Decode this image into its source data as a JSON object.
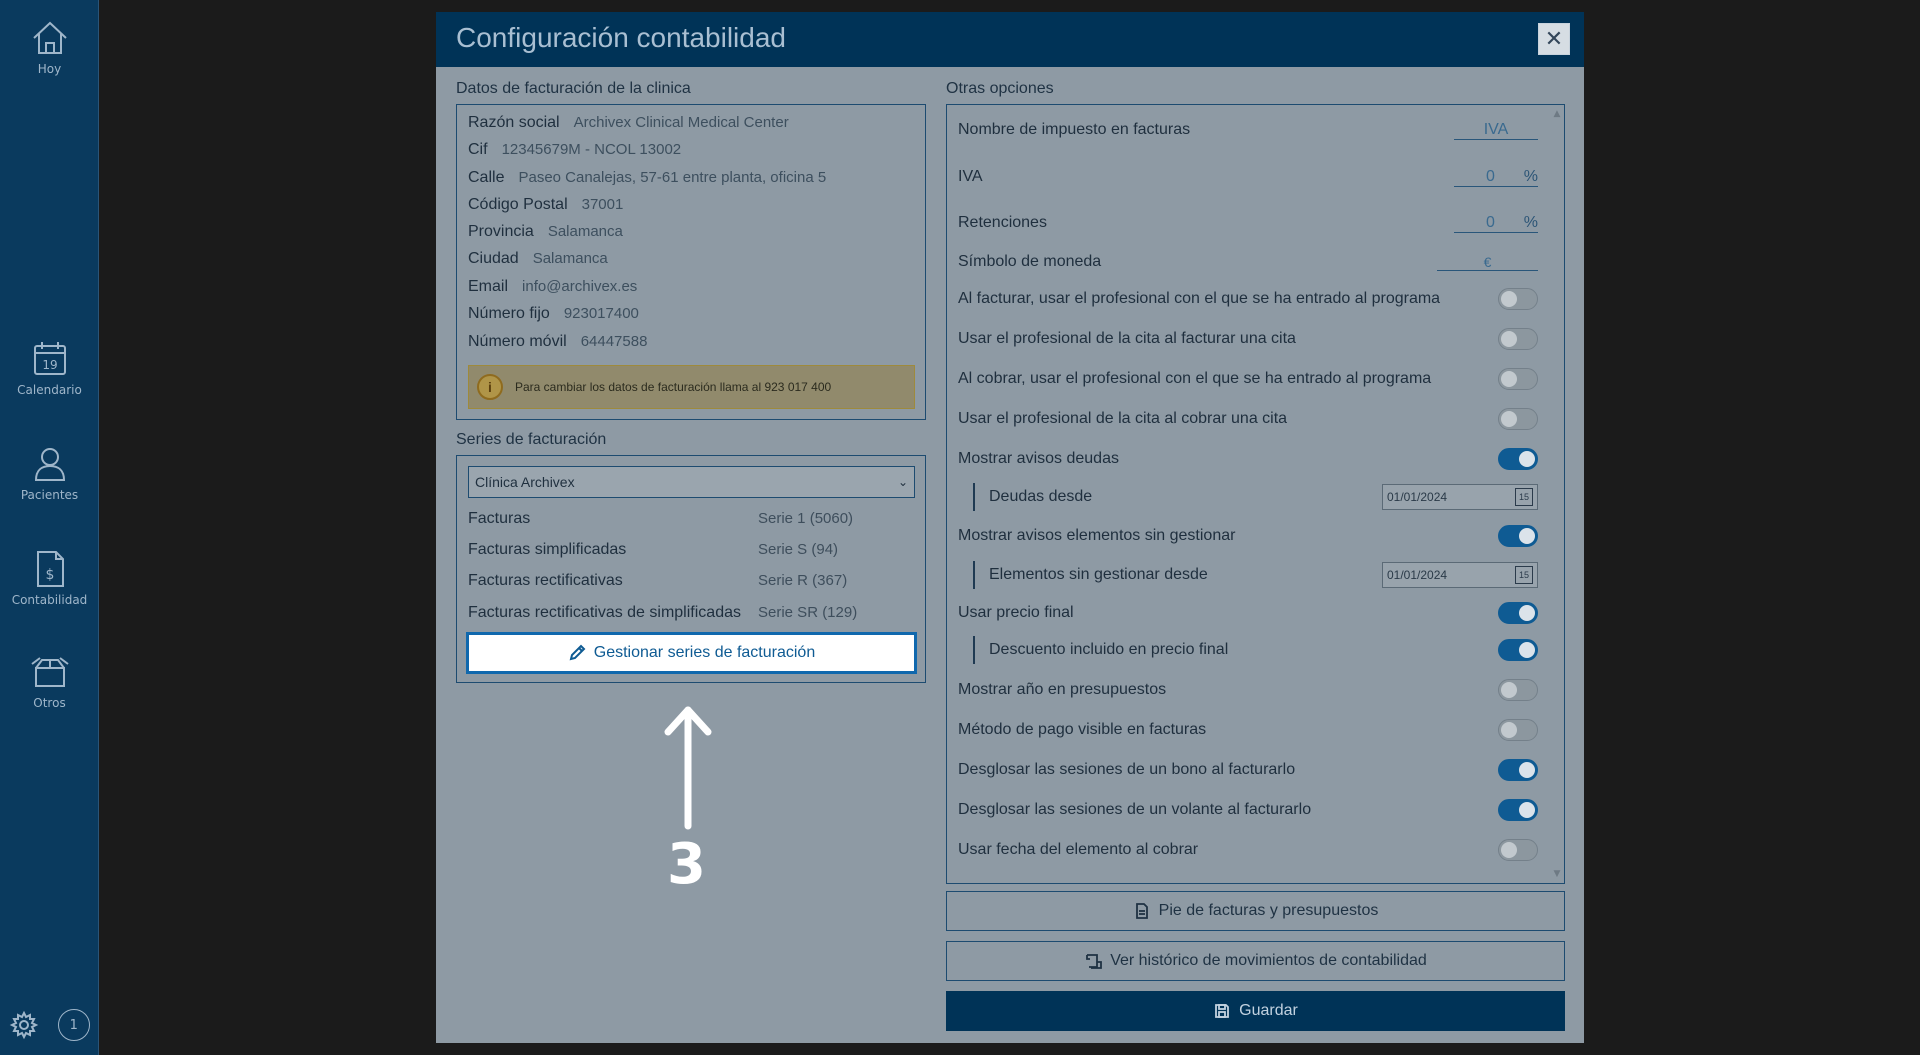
{
  "sidebar": {
    "items": [
      {
        "label": "Hoy",
        "icon": "home-icon"
      },
      {
        "label": "Calendario",
        "icon": "calendar-icon",
        "day": "19"
      },
      {
        "label": "Pacientes",
        "icon": "user-icon"
      },
      {
        "label": "Contabilidad",
        "icon": "invoice-icon"
      },
      {
        "label": "Otros",
        "icon": "box-icon"
      }
    ],
    "badge": "1"
  },
  "dialog": {
    "title": "Configuración contabilidad",
    "close": "✕"
  },
  "billing": {
    "title": "Datos de facturación de la clinica",
    "fields": [
      {
        "label": "Razón social",
        "value": "Archivex Clinical Medical Center"
      },
      {
        "label": "Cif",
        "value": "12345679M - NCOL 13002"
      },
      {
        "label": "Calle",
        "value": "Paseo Canalejas, 57-61 entre planta, oficina 5"
      },
      {
        "label": "Código Postal",
        "value": "37001"
      },
      {
        "label": "Provincia",
        "value": "Salamanca"
      },
      {
        "label": "Ciudad",
        "value": "Salamanca"
      },
      {
        "label": "Email",
        "value": "info@archivex.es"
      },
      {
        "label": "Número fijo",
        "value": "923017400"
      },
      {
        "label": "Número móvil",
        "value": "64447588"
      }
    ],
    "notice": "Para cambiar los datos de facturación llama al 923 017 400"
  },
  "series": {
    "title": "Series de facturación",
    "selected": "Clínica Archivex",
    "rows": [
      {
        "label": "Facturas",
        "value": "Serie 1 (5060)"
      },
      {
        "label": "Facturas simplificadas",
        "value": "Serie S (94)"
      },
      {
        "label": "Facturas rectificativas",
        "value": "Serie R (367)"
      },
      {
        "label": "Facturas rectificativas de simplificadas",
        "value": "Serie SR (129)"
      }
    ],
    "manage_label": "Gestionar series de facturación"
  },
  "options": {
    "title": "Otras opciones",
    "tax_name_label": "Nombre de impuesto en facturas",
    "tax_name_value": "IVA",
    "iva_label": "IVA",
    "iva_value": "0",
    "ret_label": "Retenciones",
    "ret_value": "0",
    "pct": "%",
    "currency_label": "Símbolo de moneda",
    "currency_value": "€",
    "toggles": [
      {
        "label": "Al facturar, usar el profesional con el que se ha entrado al programa",
        "on": false
      },
      {
        "label": "Usar el profesional de la cita al facturar una cita",
        "on": false
      },
      {
        "label": "Al cobrar, usar el profesional con el que se ha entrado al programa",
        "on": false
      },
      {
        "label": "Usar el profesional de la cita al cobrar una cita",
        "on": false
      },
      {
        "label": "Mostrar avisos deudas",
        "on": true
      },
      {
        "label": "Deudas desde",
        "date": "01/01/2024"
      },
      {
        "label": "Mostrar avisos elementos sin gestionar",
        "on": true
      },
      {
        "label": "Elementos sin gestionar desde",
        "date": "01/01/2024"
      },
      {
        "label": "Usar precio final",
        "on": true
      },
      {
        "label": "Descuento incluido en precio final",
        "on": true
      },
      {
        "label": "Mostrar año en presupuestos",
        "on": false
      },
      {
        "label": "Método de pago visible en facturas",
        "on": false
      },
      {
        "label": "Desglosar las sesiones de un bono al facturarlo",
        "on": true
      },
      {
        "label": "Desglosar las sesiones de un volante al facturarlo",
        "on": true
      },
      {
        "label": "Usar fecha del elemento al cobrar",
        "on": false
      }
    ],
    "calendar_glyph": "15"
  },
  "actions": {
    "footer_label": "Pie de facturas y presupuestos",
    "history_label": "Ver histórico de movimientos de contabilidad",
    "save_label": "Guardar"
  },
  "annotation": {
    "number": "3"
  }
}
